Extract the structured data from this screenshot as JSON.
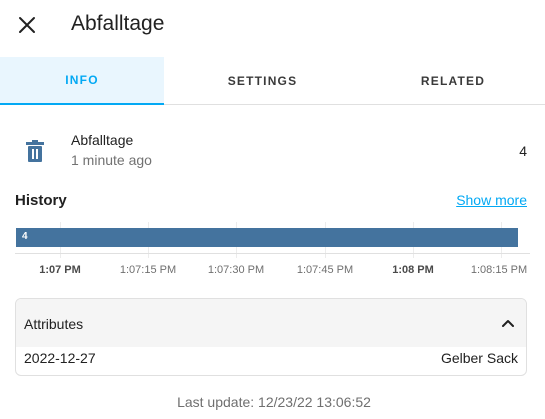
{
  "dialog": {
    "title": "Abfalltage",
    "close_icon": "close-icon"
  },
  "tabs": [
    {
      "label": "INFO",
      "active": true
    },
    {
      "label": "SETTINGS",
      "active": false
    },
    {
      "label": "RELATED",
      "active": false
    }
  ],
  "entity": {
    "name": "Abfalltage",
    "last_changed": "1 minute ago",
    "state": "4",
    "icon": "trash-can-icon",
    "icon_color": "#44739e"
  },
  "history": {
    "label": "History",
    "show_more": "Show more",
    "timeline": {
      "segments": [
        {
          "value": "4",
          "fraction": 1.0,
          "color": "#44739e"
        }
      ],
      "ticks": [
        {
          "label": "1:07 PM",
          "major": true
        },
        {
          "label": "1:07:15 PM",
          "major": false
        },
        {
          "label": "1:07:30 PM",
          "major": false
        },
        {
          "label": "1:07:45 PM",
          "major": false
        },
        {
          "label": "1:08 PM",
          "major": true
        },
        {
          "label": "1:08:15 PM",
          "major": false
        }
      ]
    }
  },
  "attributes": {
    "title": "Attributes",
    "expanded": true,
    "rows": [
      {
        "key": "2022-12-27",
        "value": "Gelber Sack"
      }
    ]
  },
  "footer": {
    "last_update": "Last update: 12/23/22 13:06:52"
  },
  "colors": {
    "accent": "#03a9f4",
    "active_tab_bg": "#e9f6fe",
    "timeline_bar": "#44739e"
  }
}
